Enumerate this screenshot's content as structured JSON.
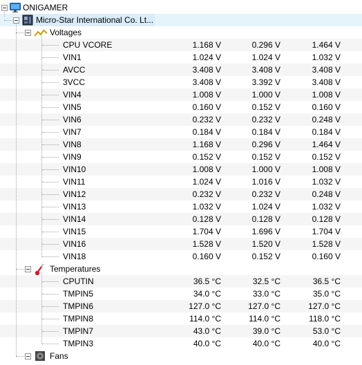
{
  "tree": {
    "root": {
      "label": "ONIGAMER",
      "icon": "monitor-icon"
    },
    "board": {
      "label": "Micro-Star International Co. Lt...",
      "icon": "motherboard-icon"
    },
    "groups": [
      {
        "label": "Voltages",
        "icon": "voltage-icon",
        "sensors": [
          {
            "name": "CPU VCORE",
            "value": "1.168 V",
            "min": "0.296 V",
            "max": "1.464 V"
          },
          {
            "name": "VIN1",
            "value": "1.024 V",
            "min": "1.024 V",
            "max": "1.032 V"
          },
          {
            "name": "AVCC",
            "value": "3.408 V",
            "min": "3.408 V",
            "max": "3.408 V"
          },
          {
            "name": "3VCC",
            "value": "3.408 V",
            "min": "3.392 V",
            "max": "3.408 V"
          },
          {
            "name": "VIN4",
            "value": "1.008 V",
            "min": "1.000 V",
            "max": "1.008 V"
          },
          {
            "name": "VIN5",
            "value": "0.160 V",
            "min": "0.152 V",
            "max": "0.160 V"
          },
          {
            "name": "VIN6",
            "value": "0.232 V",
            "min": "0.232 V",
            "max": "0.248 V"
          },
          {
            "name": "VIN7",
            "value": "0.184 V",
            "min": "0.184 V",
            "max": "0.184 V"
          },
          {
            "name": "VIN8",
            "value": "1.168 V",
            "min": "0.296 V",
            "max": "1.464 V"
          },
          {
            "name": "VIN9",
            "value": "0.152 V",
            "min": "0.152 V",
            "max": "0.152 V"
          },
          {
            "name": "VIN10",
            "value": "1.008 V",
            "min": "1.000 V",
            "max": "1.008 V"
          },
          {
            "name": "VIN11",
            "value": "1.024 V",
            "min": "1.016 V",
            "max": "1.032 V"
          },
          {
            "name": "VIN12",
            "value": "0.232 V",
            "min": "0.232 V",
            "max": "0.248 V"
          },
          {
            "name": "VIN13",
            "value": "1.032 V",
            "min": "1.024 V",
            "max": "1.032 V"
          },
          {
            "name": "VIN14",
            "value": "0.128 V",
            "min": "0.128 V",
            "max": "0.128 V"
          },
          {
            "name": "VIN15",
            "value": "1.704 V",
            "min": "1.696 V",
            "max": "1.704 V"
          },
          {
            "name": "VIN16",
            "value": "1.528 V",
            "min": "1.520 V",
            "max": "1.528 V"
          },
          {
            "name": "VIN18",
            "value": "0.160 V",
            "min": "0.152 V",
            "max": "0.160 V"
          }
        ]
      },
      {
        "label": "Temperatures",
        "icon": "thermometer-icon",
        "sensors": [
          {
            "name": "CPUTIN",
            "value": "36.5 °C",
            "min": "32.5 °C",
            "max": "36.5 °C"
          },
          {
            "name": "TMPIN5",
            "value": "34.0 °C",
            "min": "33.0 °C",
            "max": "35.0 °C"
          },
          {
            "name": "TMPIN6",
            "value": "127.0 °C",
            "min": "127.0 °C",
            "max": "127.0 °C"
          },
          {
            "name": "TMPIN8",
            "value": "114.0 °C",
            "min": "114.0 °C",
            "max": "118.0 °C"
          },
          {
            "name": "TMPIN7",
            "value": "43.0 °C",
            "min": "39.0 °C",
            "max": "53.0 °C"
          },
          {
            "name": "TMPIN3",
            "value": "40.0 °C",
            "min": "40.0 °C",
            "max": "40.0 °C"
          }
        ]
      },
      {
        "label": "Fans",
        "icon": "fan-icon",
        "sensors": []
      }
    ]
  }
}
